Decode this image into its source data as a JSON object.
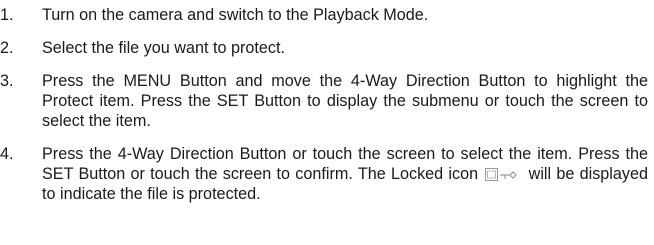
{
  "steps": [
    {
      "number": "1.",
      "text": "Turn on the camera and switch to the Playback Mode."
    },
    {
      "number": "2.",
      "text": "Select the file you want to protect."
    },
    {
      "number": "3.",
      "text": "Press the MENU Button and move the 4-Way Direction Button to highlight the Protect item. Press the SET Button to display the submenu or touch the screen to select the item."
    },
    {
      "number": "4.",
      "text_before_icon": "Press the 4-Way Direction Button or touch the screen to select the item. Press the SET Button or touch the screen to confirm. The Locked icon",
      "icon": "locked-file-icon",
      "text_after_icon": "will be displayed to indicate the file is protected."
    }
  ],
  "colors": {
    "text": "#1a1a1a",
    "icon_stroke": "#9a9a9a"
  }
}
